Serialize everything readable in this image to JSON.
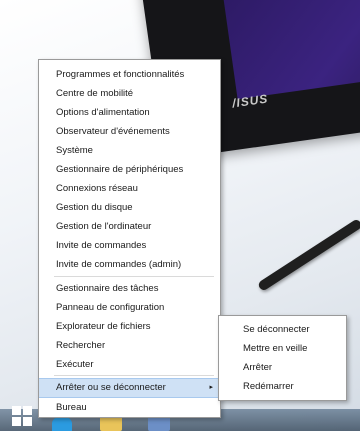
{
  "desktop": {
    "tablet_logo": "/ISUS"
  },
  "context_menu": {
    "items": [
      {
        "label": "Programmes et fonctionnalités"
      },
      {
        "label": "Centre de mobilité"
      },
      {
        "label": "Options d'alimentation"
      },
      {
        "label": "Observateur d'événements"
      },
      {
        "label": "Système"
      },
      {
        "label": "Gestionnaire de périphériques"
      },
      {
        "label": "Connexions réseau"
      },
      {
        "label": "Gestion du disque"
      },
      {
        "label": "Gestion de l'ordinateur"
      },
      {
        "label": "Invite de commandes"
      },
      {
        "label": "Invite de commandes (admin)"
      },
      {
        "label": "Gestionnaire des tâches"
      },
      {
        "label": "Panneau de configuration"
      },
      {
        "label": "Explorateur de fichiers"
      },
      {
        "label": "Rechercher"
      },
      {
        "label": "Exécuter"
      },
      {
        "label": "Arrêter ou se déconnecter",
        "highlighted": true,
        "has_submenu": true
      },
      {
        "label": "Bureau"
      }
    ],
    "submenu_arrow": "▸"
  },
  "shutdown_submenu": {
    "items": [
      {
        "label": "Se déconnecter"
      },
      {
        "label": "Mettre en veille"
      },
      {
        "label": "Arrêter"
      },
      {
        "label": "Redémarrer"
      }
    ]
  },
  "taskbar": {
    "icons": [
      "windows-start-icon",
      "internet-explorer-icon",
      "file-explorer-icon",
      "store-icon"
    ]
  }
}
